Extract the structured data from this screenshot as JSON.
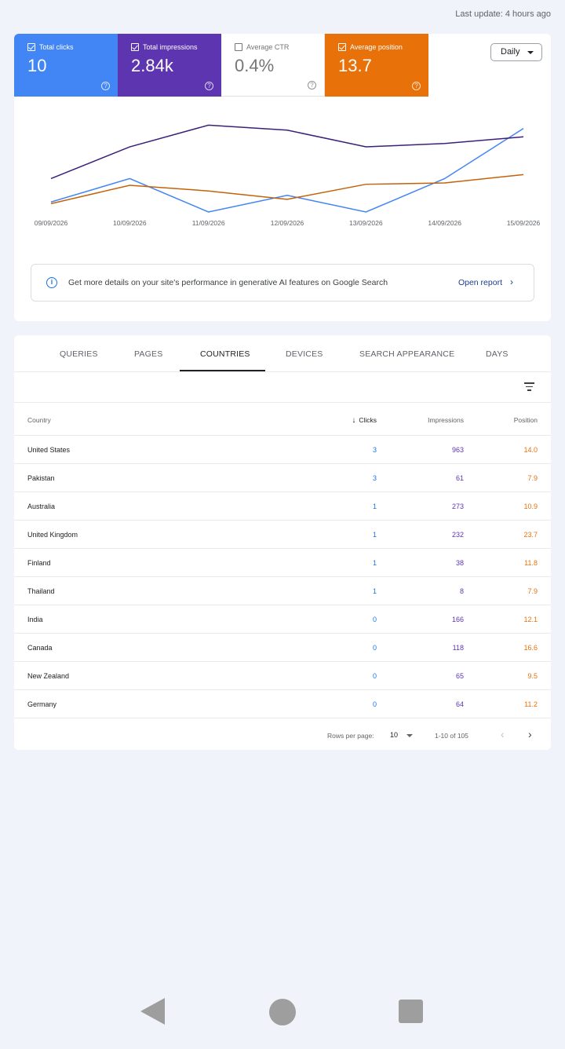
{
  "header": {
    "last_update": "Last update: 4 hours ago"
  },
  "metrics": [
    {
      "label": "Total clicks",
      "value": "10",
      "checked": true,
      "color": "#4285f4"
    },
    {
      "label": "Total impressions",
      "value": "2.84k",
      "checked": true,
      "color": "#5e35b1"
    },
    {
      "label": "Average CTR",
      "value": "0.4%",
      "checked": false,
      "color": "#757575"
    },
    {
      "label": "Average position",
      "value": "13.7",
      "checked": true,
      "color": "#e8710a"
    }
  ],
  "help_glyph": "?",
  "granularity": {
    "selected": "Daily"
  },
  "chart_data": {
    "type": "line",
    "x": [
      "09/09/2026",
      "10/09/2026",
      "11/09/2026",
      "12/09/2026",
      "13/09/2026",
      "14/09/2026",
      "15/09/2026"
    ],
    "series": [
      {
        "name": "Total clicks",
        "color": "#4285f4",
        "values": [
          0.3,
          1.0,
          0.0,
          0.5,
          0.0,
          1.0,
          2.5
        ]
      },
      {
        "name": "Total impressions",
        "color": "#3b1f78",
        "values": [
          1.0,
          1.95,
          2.6,
          2.45,
          1.95,
          2.05,
          2.25
        ]
      },
      {
        "name": "Average position",
        "color": "#c2620a",
        "values": [
          0.25,
          0.8,
          0.63,
          0.38,
          0.83,
          0.87,
          1.12
        ]
      }
    ],
    "ylim": [
      0,
      2.75
    ],
    "grid": false,
    "legend": "none"
  },
  "ai_banner": {
    "info_glyph": "i",
    "message": "Get more details on your site's performance in generative AI features on Google Search",
    "link": "Open report",
    "link_chevron": "›"
  },
  "tabs": [
    {
      "label": "QUERIES",
      "active": false
    },
    {
      "label": "PAGES",
      "active": false
    },
    {
      "label": "COUNTRIES",
      "active": true
    },
    {
      "label": "DEVICES",
      "active": false
    },
    {
      "label": "SEARCH APPEARANCE",
      "active": false
    },
    {
      "label": "DAYS",
      "active": false
    }
  ],
  "table": {
    "headers": {
      "country": "Country",
      "sort_arrow": "↓",
      "clicks": "Clicks",
      "impressions": "Impressions",
      "position": "Position"
    },
    "rows": [
      {
        "country": "United States",
        "clicks": "3",
        "impressions": "963",
        "position": "14.0"
      },
      {
        "country": "Pakistan",
        "clicks": "3",
        "impressions": "61",
        "position": "7.9"
      },
      {
        "country": "Australia",
        "clicks": "1",
        "impressions": "273",
        "position": "10.9"
      },
      {
        "country": "United Kingdom",
        "clicks": "1",
        "impressions": "232",
        "position": "23.7"
      },
      {
        "country": "Finland",
        "clicks": "1",
        "impressions": "38",
        "position": "11.8"
      },
      {
        "country": "Thailand",
        "clicks": "1",
        "impressions": "8",
        "position": "7.9"
      },
      {
        "country": "India",
        "clicks": "0",
        "impressions": "166",
        "position": "12.1"
      },
      {
        "country": "Canada",
        "clicks": "0",
        "impressions": "118",
        "position": "16.6"
      },
      {
        "country": "New Zealand",
        "clicks": "0",
        "impressions": "65",
        "position": "9.5"
      },
      {
        "country": "Germany",
        "clicks": "0",
        "impressions": "64",
        "position": "11.2"
      }
    ]
  },
  "pagination": {
    "rows_per_page_label": "Rows per page:",
    "rows_per_page": "10",
    "range": "1-10 of 105",
    "prev_glyph": "‹",
    "next_glyph": "›"
  },
  "system_nav": {
    "back_icon": "back-triangle",
    "home_icon": "home-circle",
    "recents_icon": "recents-square"
  }
}
